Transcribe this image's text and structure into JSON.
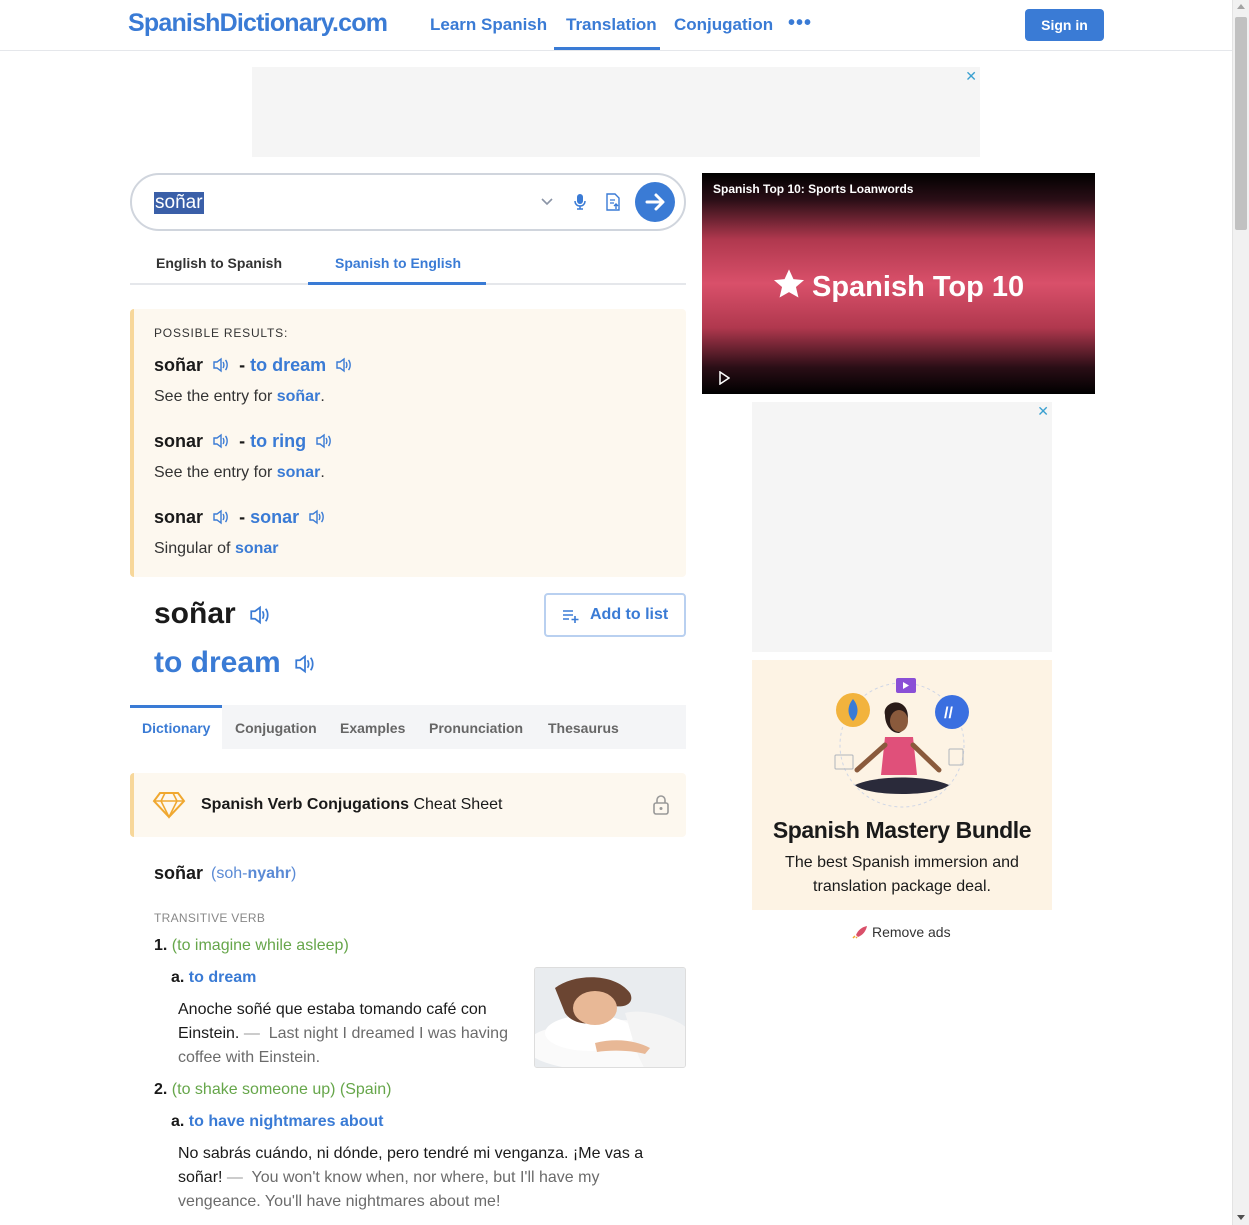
{
  "header": {
    "logo": "SpanishDictionary.com",
    "nav": [
      "Learn Spanish",
      "Translation",
      "Conjugation"
    ],
    "more": "•••",
    "signin": "Sign in"
  },
  "ads": {
    "close": "✕",
    "remove": "Remove ads"
  },
  "search": {
    "value": "soñar",
    "directions": [
      "English to Spanish",
      "Spanish to English"
    ]
  },
  "results": {
    "label": "POSSIBLE RESULTS:",
    "items": [
      {
        "word": "soñar",
        "sep": "-",
        "trans": "to dream",
        "note_pre": "See the entry for ",
        "note_link": "soñar",
        "note_post": "."
      },
      {
        "word": "sonar",
        "sep": "-",
        "trans": "to ring",
        "note_pre": "See the entry for ",
        "note_link": "sonar",
        "note_post": "."
      },
      {
        "word": "sonar",
        "sep": "-",
        "trans": "sonar",
        "note_pre": "Singular of ",
        "note_link": "sonar",
        "note_post": ""
      }
    ]
  },
  "headword": {
    "word": "soñar",
    "translation": "to dream",
    "add_to_list": "Add to list"
  },
  "tabs": [
    "Dictionary",
    "Conjugation",
    "Examples",
    "Pronunciation",
    "Thesaurus"
  ],
  "cheat": {
    "bold": "Spanish Verb Conjugations",
    "rest": " Cheat Sheet"
  },
  "entry": {
    "word": "soñar",
    "pron_open": "(soh-",
    "pron_stress": "nyahr",
    "pron_close": ")",
    "pos": "TRANSITIVE VERB",
    "senses": [
      {
        "num": "1.",
        "context": "(to imagine while asleep)",
        "sub": "a.",
        "trans": "to dream",
        "es_1": "Anoche soñé que estaba tomando café con",
        "es_2": "Einstein.",
        "dash": "—",
        "en_1": "Last night I dreamed I was having",
        "en_2": "coffee with Einstein."
      },
      {
        "num": "2.",
        "context": "(to shake someone up) (Spain)",
        "sub": "a.",
        "trans": "to have nightmares about",
        "es_1": "No sabrás cuándo, ni dónde, pero tendré mi venganza. ¡Me vas a",
        "es_2": "soñar!",
        "dash": "—",
        "en_1": "You won't know when, nor where, but I'll have my",
        "en_2": "vengeance. You'll have nightmares about me!"
      }
    ]
  },
  "video": {
    "title": "Spanish Top 10: Sports Loanwords",
    "brand": "Spanish Top 10"
  },
  "bundle": {
    "title": "Spanish Mastery Bundle",
    "sub_1": "The best Spanish immersion and",
    "sub_2": "translation package deal."
  },
  "colors": {
    "accent": "#3a7bd5",
    "context_green": "#66a64a",
    "note_bg": "#fdf8ef",
    "note_border": "#f7d79a"
  }
}
